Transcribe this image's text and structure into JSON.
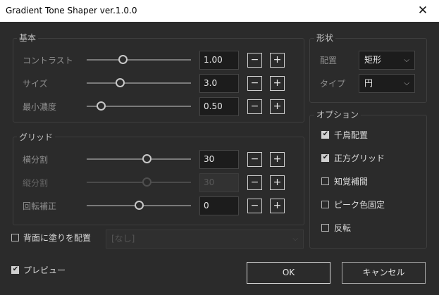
{
  "window": {
    "title": "Gradient Tone Shaper ver.1.0.0",
    "close_glyph": "✕"
  },
  "basic": {
    "label": "基本",
    "rows": [
      {
        "label": "コントラスト",
        "value": "1.00",
        "slider_fraction": 0.35,
        "enabled": true
      },
      {
        "label": "サイズ",
        "value": "3.0",
        "slider_fraction": 0.32,
        "enabled": true
      },
      {
        "label": "最小濃度",
        "value": "0.50",
        "slider_fraction": 0.14,
        "enabled": true
      }
    ]
  },
  "grid": {
    "label": "グリッド",
    "rows": [
      {
        "label": "横分割",
        "value": "30",
        "slider_fraction": 0.58,
        "enabled": true
      },
      {
        "label": "縦分割",
        "value": "30",
        "slider_fraction": 0.58,
        "enabled": false
      },
      {
        "label": "回転補正",
        "value": "0",
        "slider_fraction": 0.5,
        "enabled": true
      }
    ]
  },
  "stepper": {
    "minus": "−",
    "plus": "+"
  },
  "shape": {
    "label": "形状",
    "placement_label": "配置",
    "placement_value": "矩形",
    "type_label": "タイプ",
    "type_value": "円"
  },
  "options": {
    "label": "オプション",
    "items": [
      {
        "label": "千鳥配置",
        "checked": true
      },
      {
        "label": "正方グリッド",
        "checked": true
      },
      {
        "label": "知覚補間",
        "checked": false
      },
      {
        "label": "ピーク色固定",
        "checked": false
      },
      {
        "label": "反転",
        "checked": false
      }
    ]
  },
  "background_fill": {
    "label": "背面に塗りを配置",
    "checked": false,
    "select_value": "[なし]"
  },
  "preview": {
    "label": "プレビュー",
    "checked": true
  },
  "buttons": {
    "ok": "OK",
    "cancel": "キャンセル"
  },
  "check_glyph": "✔",
  "chevron_glyph": "⌵"
}
